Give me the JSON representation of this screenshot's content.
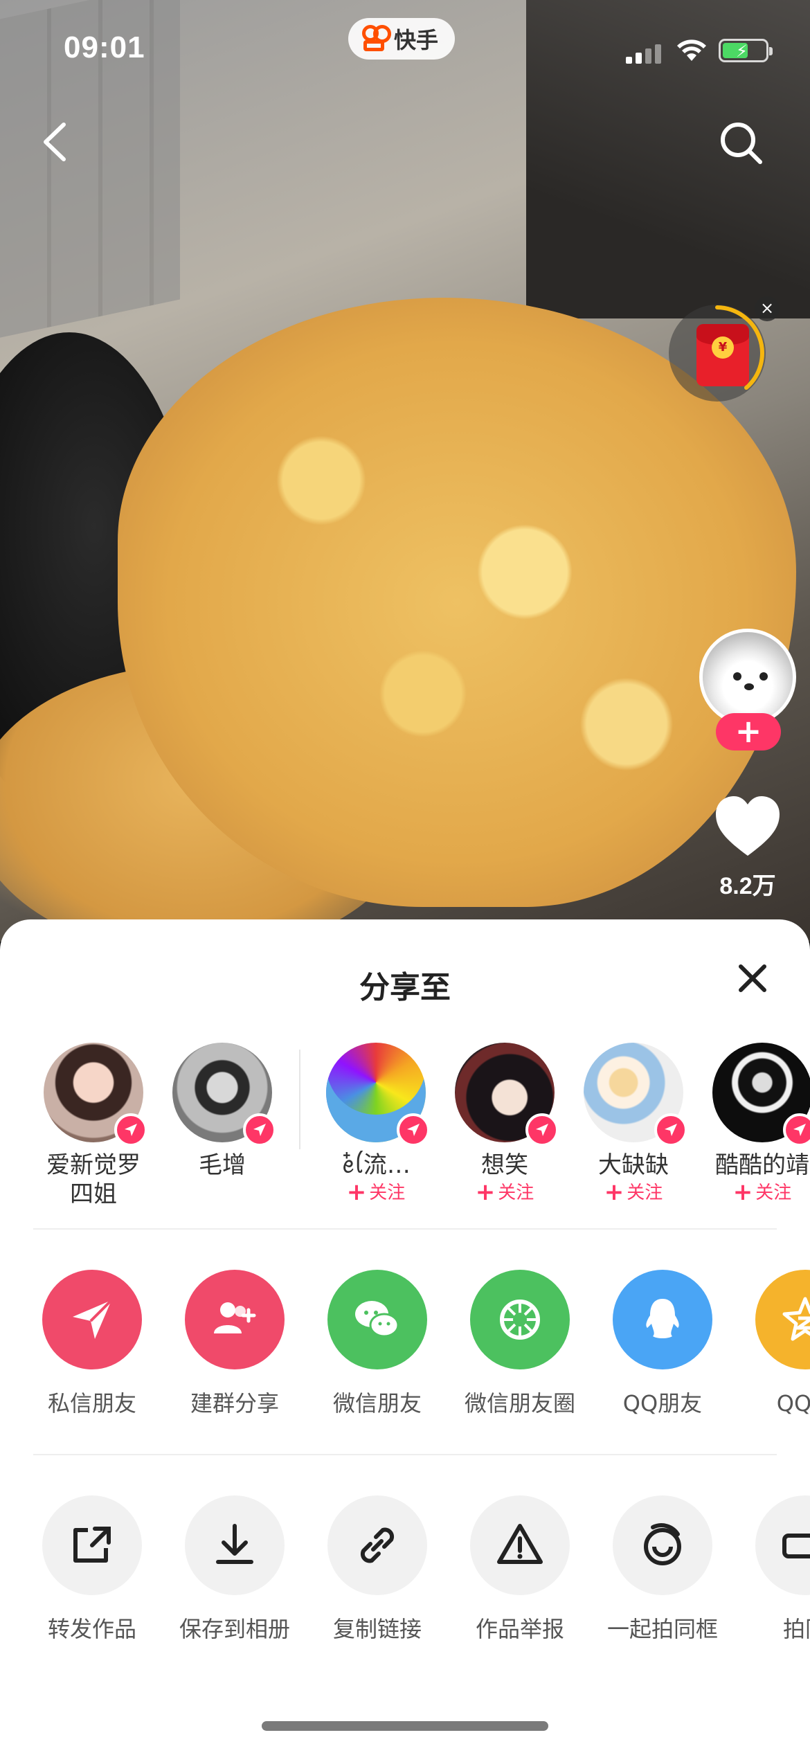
{
  "status_bar": {
    "time": "09:01",
    "app_name": "快手",
    "colors": {
      "battery": "#4cd964",
      "brand": "#ff4f00"
    }
  },
  "video": {
    "like_count": "8.2万",
    "red_packet_symbol": "¥"
  },
  "share_sheet": {
    "title": "分享至",
    "friends": [
      {
        "name": "爱新觉罗\n四姐",
        "follow": ""
      },
      {
        "name": "毛增",
        "follow": ""
      },
      {
        "name": "ꫀ໋ꪶ流…",
        "follow": "关注"
      },
      {
        "name": "想笑",
        "follow": "关注"
      },
      {
        "name": "大缺缺",
        "follow": "关注"
      },
      {
        "name": "酷酷的靖",
        "follow": "关注"
      }
    ],
    "share_targets": [
      {
        "label": "私信朋友",
        "icon": "paper-plane-icon",
        "color": "#f04a6a"
      },
      {
        "label": "建群分享",
        "icon": "add-group-icon",
        "color": "#f04a6a"
      },
      {
        "label": "微信朋友",
        "icon": "wechat-icon",
        "color": "#4cc15f"
      },
      {
        "label": "微信朋友圈",
        "icon": "moments-icon",
        "color": "#4cc15f"
      },
      {
        "label": "QQ朋友",
        "icon": "qq-icon",
        "color": "#4aa5f5"
      },
      {
        "label": "QQ空",
        "icon": "qzone-icon",
        "color": "#f5b32c"
      }
    ],
    "actions": [
      {
        "label": "转发作品",
        "icon": "forward-icon"
      },
      {
        "label": "保存到相册",
        "icon": "download-icon"
      },
      {
        "label": "复制链接",
        "icon": "link-icon"
      },
      {
        "label": "作品举报",
        "icon": "report-icon"
      },
      {
        "label": "一起拍同框",
        "icon": "duet-icon"
      },
      {
        "label": "拍同",
        "icon": "camera-icon"
      }
    ],
    "follow_color": "#fe3666"
  }
}
